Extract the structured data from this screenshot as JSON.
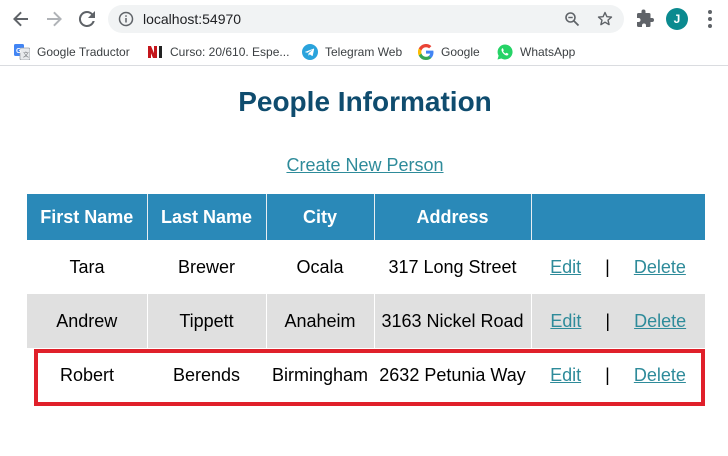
{
  "browser": {
    "url": "localhost:54970",
    "avatar_initial": "J"
  },
  "bookmarks": [
    {
      "label": "Google Traductor",
      "icon": "google-translate-icon"
    },
    {
      "label": "Curso: 20/610. Espe...",
      "icon": "ni-icon"
    },
    {
      "label": "Telegram Web",
      "icon": "telegram-icon"
    },
    {
      "label": "Google",
      "icon": "google-icon"
    },
    {
      "label": "WhatsApp",
      "icon": "whatsapp-icon"
    }
  ],
  "page": {
    "title": "People Information",
    "create_link": "Create New Person"
  },
  "table": {
    "headers": [
      "First Name",
      "Last Name",
      "City",
      "Address",
      ""
    ],
    "rows": [
      {
        "first": "Tara",
        "last": "Brewer",
        "city": "Ocala",
        "address": "317 Long Street"
      },
      {
        "first": "Andrew",
        "last": "Tippett",
        "city": "Anaheim",
        "address": "3163 Nickel Road"
      },
      {
        "first": "Robert",
        "last": "Berends",
        "city": "Birmingham",
        "address": "2632 Petunia Way"
      }
    ],
    "edit_label": "Edit",
    "separator": "|",
    "delete_label": "Delete"
  },
  "colors": {
    "header_bg": "#2a89b8",
    "title": "#0f4c6e",
    "link": "#2e8b9a",
    "highlight": "#e0202a"
  }
}
